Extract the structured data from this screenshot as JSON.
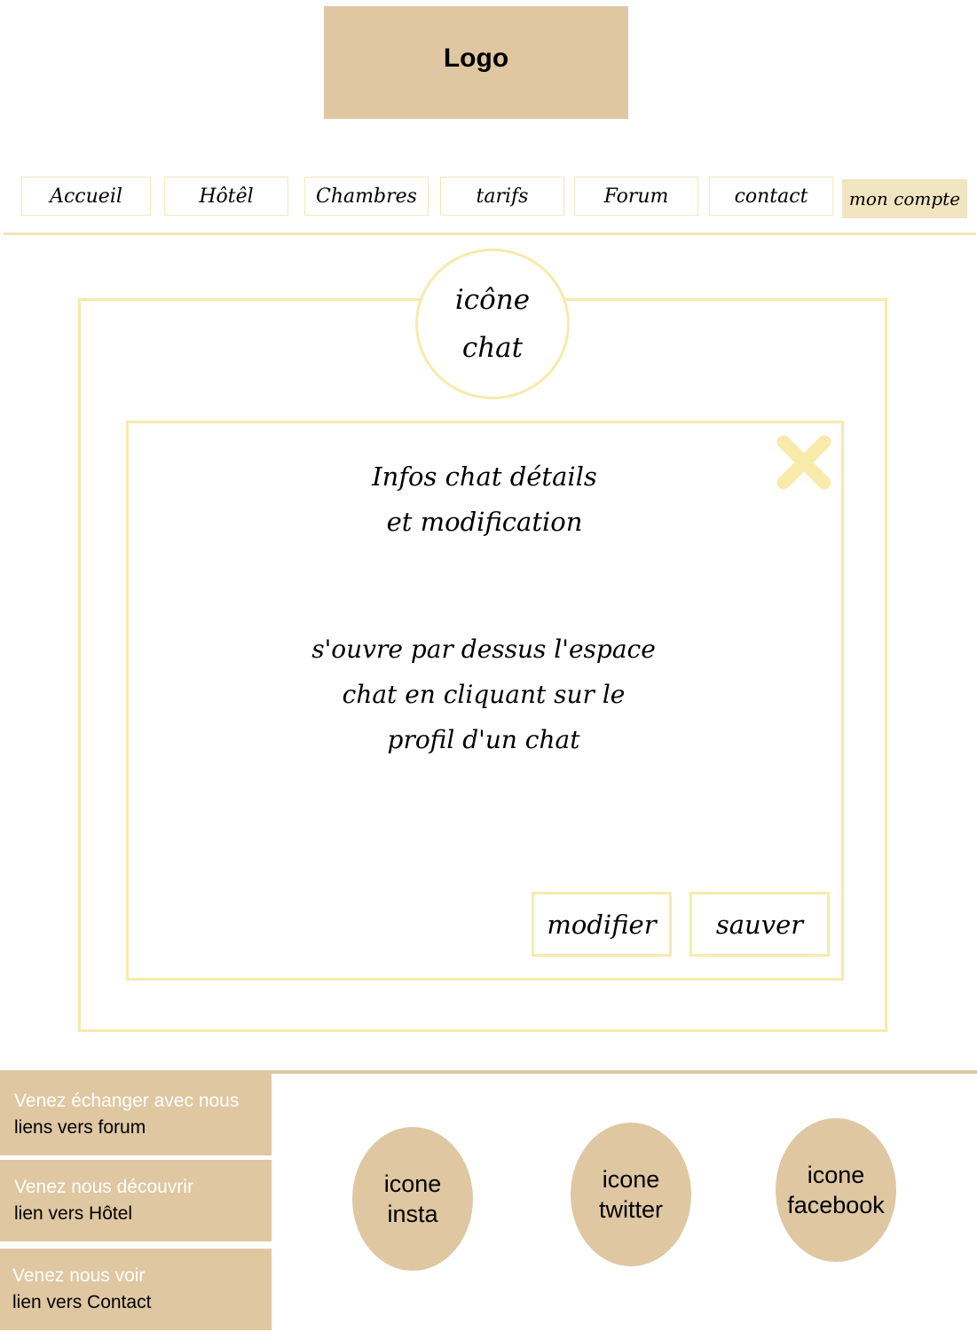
{
  "header": {
    "logo_label": "Logo"
  },
  "nav": {
    "items": [
      {
        "label": "Accueil"
      },
      {
        "label": "Hôtêl"
      },
      {
        "label": "Chambres"
      },
      {
        "label": "tarifs"
      },
      {
        "label": "Forum"
      },
      {
        "label": "contact"
      },
      {
        "label": "mon compte",
        "active": true
      }
    ]
  },
  "chat_area": {
    "icon_line1": "icône",
    "icon_line2": "chat"
  },
  "modal": {
    "close_icon": "close-x-icon",
    "title_line1": "Infos chat détails",
    "title_line2": "et modification",
    "desc_line1": "s'ouvre par dessus l'espace",
    "desc_line2": "chat en cliquant sur le",
    "desc_line3": "profil d'un chat",
    "modify_label": "modifier",
    "save_label": "sauver"
  },
  "footer": {
    "links": [
      {
        "top": "Venez échanger avec nous",
        "bottom": "liens vers forum"
      },
      {
        "top": "Venez nous découvrir",
        "bottom": "lien vers Hôtel"
      },
      {
        "top": "Venez nous voir",
        "bottom": "lien vers Contact"
      }
    ],
    "social": [
      {
        "line1": "icone",
        "line2": "insta"
      },
      {
        "line1": "icone",
        "line2": "twitter"
      },
      {
        "line1": "icone",
        "line2": "facebook"
      }
    ]
  },
  "colors": {
    "tan": "#dfc7a2",
    "pale_yellow": "#f7eaab",
    "nav_active": "#f1e4c0"
  }
}
